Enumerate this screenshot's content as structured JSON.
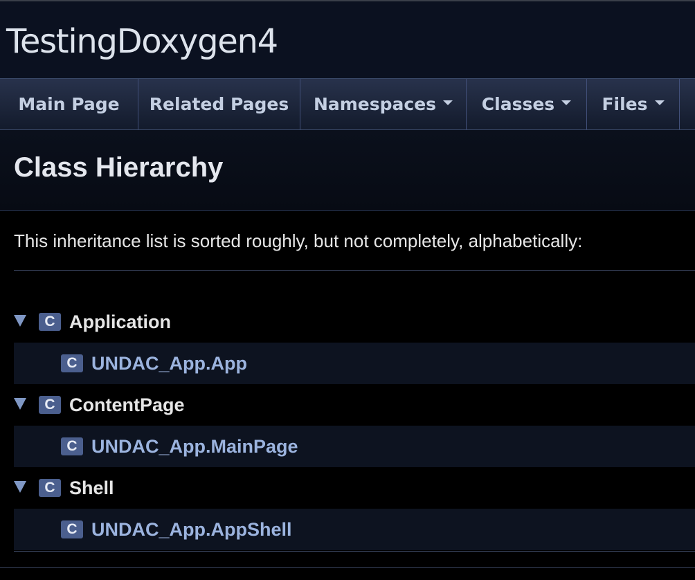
{
  "title_area": {
    "project_name": "TestingDoxygen4"
  },
  "navbar": {
    "items": [
      {
        "label": "Main Page",
        "has_dropdown": false
      },
      {
        "label": "Related Pages",
        "has_dropdown": false
      },
      {
        "label": "Namespaces",
        "has_dropdown": true
      },
      {
        "label": "Classes",
        "has_dropdown": true
      },
      {
        "label": "Files",
        "has_dropdown": true
      }
    ]
  },
  "header": {
    "title": "Class Hierarchy"
  },
  "contents": {
    "intro": "This inheritance list is sorted roughly, but not completely, alphabetically:",
    "hierarchy": [
      {
        "icon": "C",
        "label": "Application",
        "expanded": true,
        "is_link": false
      },
      {
        "icon": "C",
        "label": "UNDAC_App.App",
        "is_link": true
      },
      {
        "icon": "C",
        "label": "ContentPage",
        "expanded": true,
        "is_link": false
      },
      {
        "icon": "C",
        "label": "UNDAC_App.MainPage",
        "is_link": true
      },
      {
        "icon": "C",
        "label": "Shell",
        "expanded": true,
        "is_link": false
      },
      {
        "icon": "C",
        "label": "UNDAC_App.AppShell",
        "is_link": true
      }
    ]
  },
  "colors": {
    "background": "#000000",
    "nav_text": "#c4cfe2",
    "link_text": "#9bb3de",
    "class_icon_bg": "#4b5f8e",
    "arrow": "#7f97c4"
  }
}
